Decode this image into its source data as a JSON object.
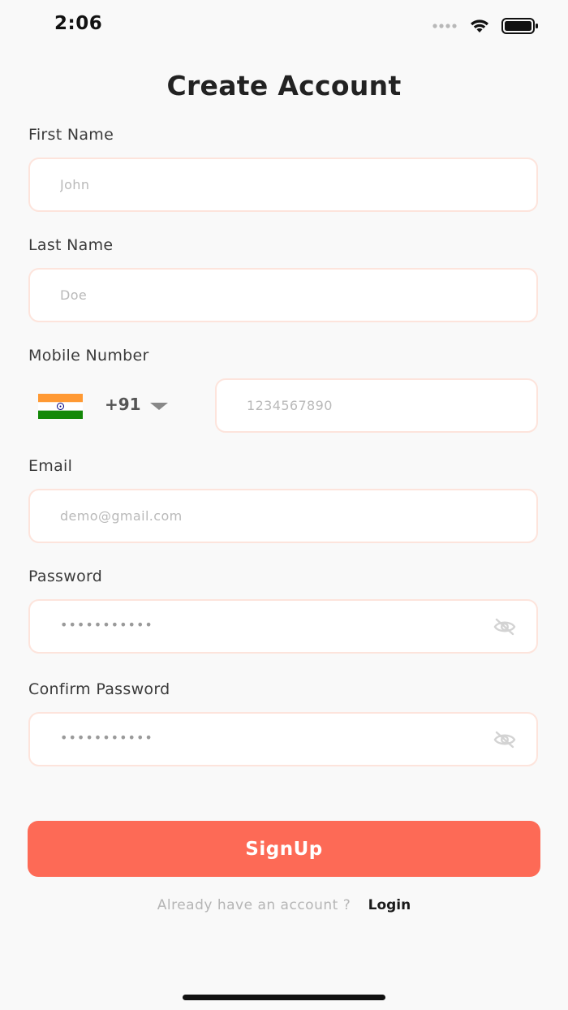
{
  "status_bar": {
    "time": "2:06"
  },
  "page": {
    "title": "Create Account"
  },
  "form": {
    "first_name": {
      "label": "First Name",
      "placeholder": "John"
    },
    "last_name": {
      "label": "Last Name",
      "placeholder": "Doe"
    },
    "mobile": {
      "label": "Mobile Number",
      "country_code": "+91",
      "flag": "india-flag-icon",
      "placeholder": "1234567890"
    },
    "email": {
      "label": "Email",
      "placeholder": "demo@gmail.com"
    },
    "password": {
      "label": "Password",
      "masked_value": "•••••••••••",
      "visibility_icon": "eye-off-icon"
    },
    "confirm_password": {
      "label": "Confirm Password",
      "masked_value": "•••••••••••",
      "visibility_icon": "eye-off-icon"
    }
  },
  "actions": {
    "signup_label": "SignUp"
  },
  "footer": {
    "question": "Already have an account ?",
    "login_label": "Login"
  },
  "colors": {
    "accent": "#fd6a56",
    "field_border": "#fde4dc",
    "background": "#f9f9f9"
  }
}
